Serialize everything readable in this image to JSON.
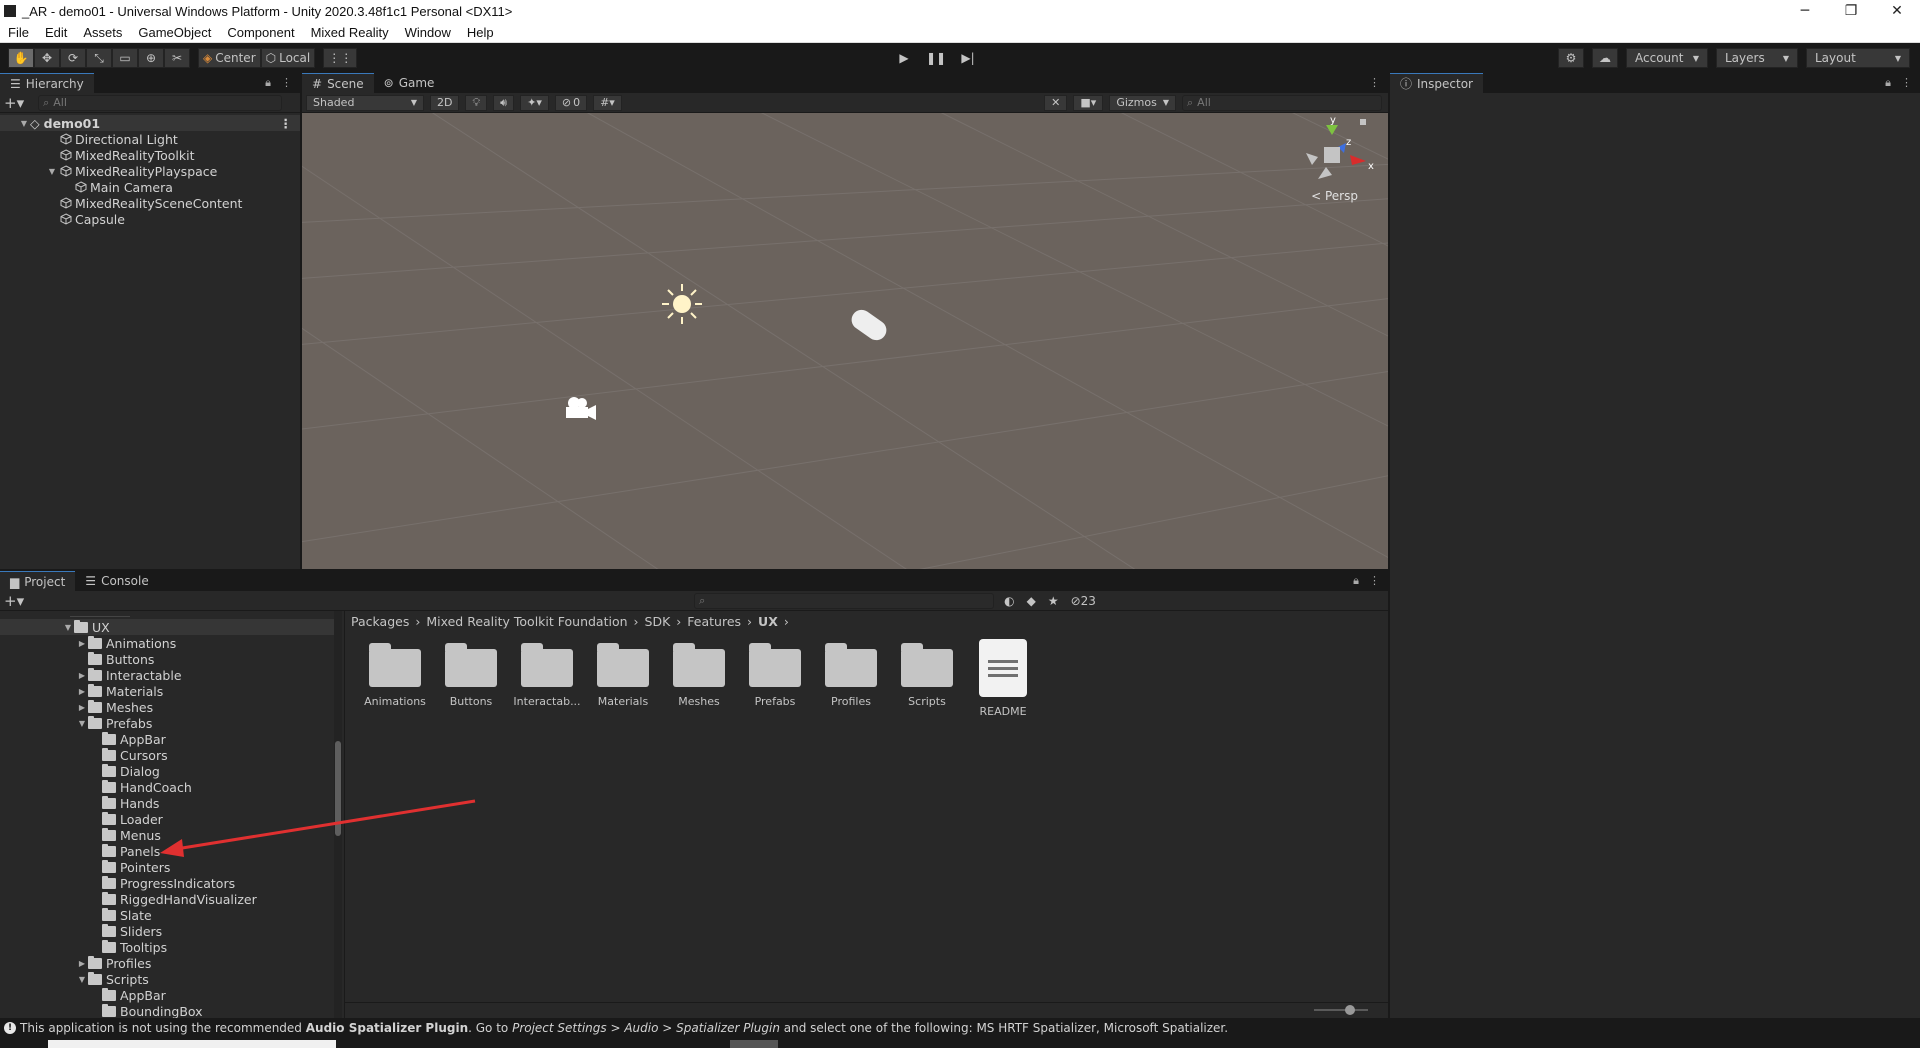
{
  "window": {
    "title": "_AR - demo01 - Universal Windows Platform - Unity 2020.3.48f1c1 Personal <DX11>",
    "min": "─",
    "max": "❐",
    "close": "✕"
  },
  "menu": [
    "File",
    "Edit",
    "Assets",
    "GameObject",
    "Component",
    "Mixed Reality",
    "Window",
    "Help"
  ],
  "toolbar": {
    "pivot_label": "Center",
    "space_label": "Local",
    "account_label": "Account",
    "layers_label": "Layers",
    "layout_label": "Layout"
  },
  "hierarchy": {
    "tab": "Hierarchy",
    "search_placeholder": "All",
    "scene": "demo01",
    "items": [
      "Directional Light",
      "MixedRealityToolkit",
      "MixedRealityPlayspace",
      "Main Camera",
      "MixedRealitySceneContent",
      "Capsule"
    ]
  },
  "scene": {
    "tab_scene": "Scene",
    "tab_game": "Game",
    "shading": "Shaded",
    "mode_2d": "2D",
    "hidden_count": "0",
    "gizmos": "Gizmos",
    "search_placeholder": "All",
    "persp": "< Persp",
    "axis_x": "x",
    "axis_y": "y",
    "axis_z": "z"
  },
  "inspector": {
    "tab": "Inspector"
  },
  "project": {
    "tab_project": "Project",
    "tab_console": "Console",
    "hidden_count": "23",
    "tree": [
      {
        "label": "UX",
        "depth": 0,
        "tri": "▼",
        "open": true
      },
      {
        "label": "Animations",
        "depth": 1,
        "tri": "▶"
      },
      {
        "label": "Buttons",
        "depth": 1,
        "tri": ""
      },
      {
        "label": "Interactable",
        "depth": 1,
        "tri": "▶"
      },
      {
        "label": "Materials",
        "depth": 1,
        "tri": "▶"
      },
      {
        "label": "Meshes",
        "depth": 1,
        "tri": "▶"
      },
      {
        "label": "Prefabs",
        "depth": 1,
        "tri": "▼",
        "open": true
      },
      {
        "label": "AppBar",
        "depth": 2,
        "tri": ""
      },
      {
        "label": "Cursors",
        "depth": 2,
        "tri": ""
      },
      {
        "label": "Dialog",
        "depth": 2,
        "tri": ""
      },
      {
        "label": "HandCoach",
        "depth": 2,
        "tri": ""
      },
      {
        "label": "Hands",
        "depth": 2,
        "tri": ""
      },
      {
        "label": "Loader",
        "depth": 2,
        "tri": ""
      },
      {
        "label": "Menus",
        "depth": 2,
        "tri": ""
      },
      {
        "label": "Panels",
        "depth": 2,
        "tri": ""
      },
      {
        "label": "Pointers",
        "depth": 2,
        "tri": ""
      },
      {
        "label": "ProgressIndicators",
        "depth": 2,
        "tri": ""
      },
      {
        "label": "RiggedHandVisualizer",
        "depth": 2,
        "tri": ""
      },
      {
        "label": "Slate",
        "depth": 2,
        "tri": ""
      },
      {
        "label": "Sliders",
        "depth": 2,
        "tri": ""
      },
      {
        "label": "Tooltips",
        "depth": 2,
        "tri": ""
      },
      {
        "label": "Profiles",
        "depth": 1,
        "tri": "▶"
      },
      {
        "label": "Scripts",
        "depth": 1,
        "tri": "▼",
        "open": true
      },
      {
        "label": "AppBar",
        "depth": 2,
        "tri": ""
      },
      {
        "label": "BoundingBox",
        "depth": 2,
        "tri": ""
      }
    ],
    "breadcrumb": [
      "Packages",
      "Mixed Reality Toolkit Foundation",
      "SDK",
      "Features",
      "UX"
    ],
    "assets": [
      {
        "label": "Animations",
        "kind": "folder"
      },
      {
        "label": "Buttons",
        "kind": "folder"
      },
      {
        "label": "Interactab...",
        "kind": "folder"
      },
      {
        "label": "Materials",
        "kind": "folder"
      },
      {
        "label": "Meshes",
        "kind": "folder"
      },
      {
        "label": "Prefabs",
        "kind": "folder"
      },
      {
        "label": "Profiles",
        "kind": "folder"
      },
      {
        "label": "Scripts",
        "kind": "folder"
      },
      {
        "label": "README",
        "kind": "doc"
      }
    ],
    "zoom_level": 0.7
  },
  "status": {
    "prefix": "This application is not using the recommended ",
    "plugin": "Audio Spatializer Plugin",
    "mid": ". Go to ",
    "path": "Project Settings > Audio > Spatializer Plugin",
    "suffix": " and select one of the following: MS HRTF Spatializer, Microsoft Spatializer."
  },
  "colors": {
    "annotation_arrow": "#e03030",
    "accent_tab": "#3a79bb",
    "scene_bg": "#6b635d"
  }
}
